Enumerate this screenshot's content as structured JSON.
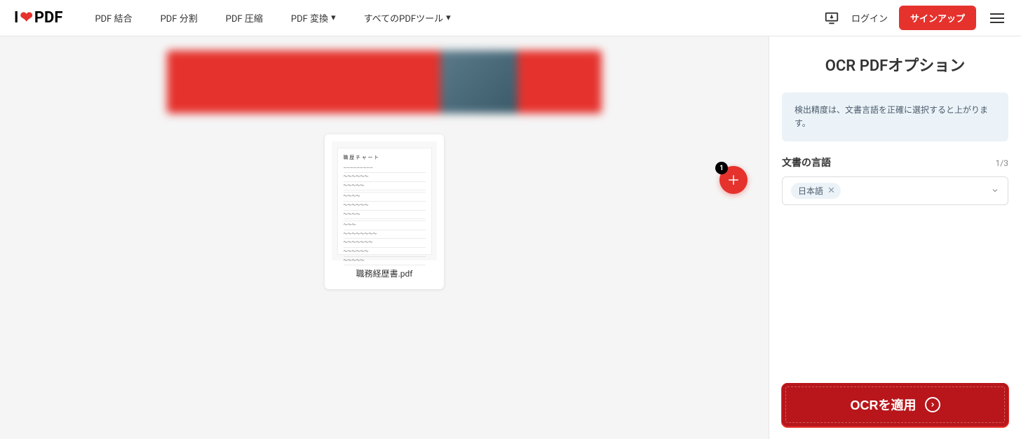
{
  "logo": {
    "prefix": "I",
    "suffix": "PDF"
  },
  "nav": {
    "merge": "PDF 結合",
    "split": "PDF 分割",
    "compress": "PDF 圧縮",
    "convert": "PDF 変換",
    "all": "すべてのPDFツール"
  },
  "auth": {
    "login": "ログイン",
    "signup": "サインアップ"
  },
  "workspace": {
    "file_name": "職務経歴書.pdf",
    "add_badge": "1"
  },
  "sidebar": {
    "title": "OCR PDFオプション",
    "info": "検出精度は、文書言語を正確に選択すると上がります。",
    "language_label": "文書の言語",
    "language_count": "1/3",
    "selected_language": "日本語",
    "apply_button": "OCRを適用"
  }
}
